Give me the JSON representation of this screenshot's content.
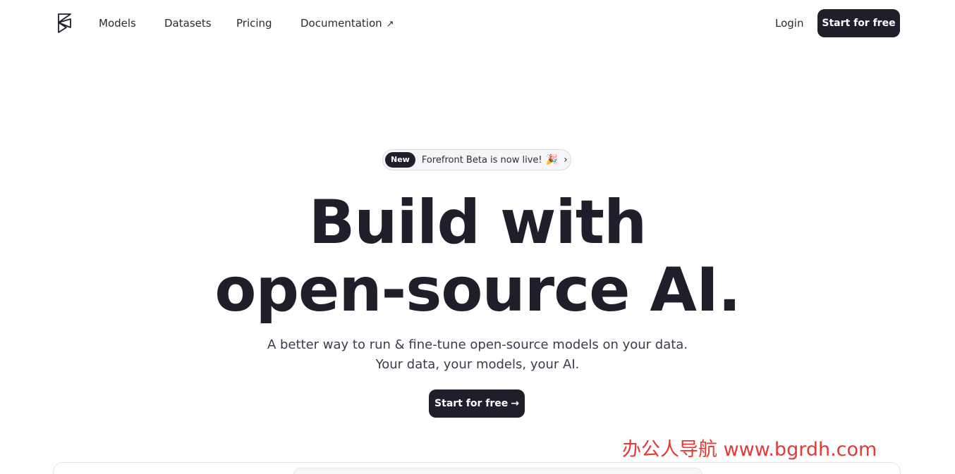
{
  "nav": {
    "links": [
      "Models",
      "Datasets",
      "Pricing",
      "Documentation"
    ],
    "docs_external_icon": "↗",
    "login": "Login",
    "cta": "Start for free"
  },
  "announcement": {
    "badge": "New",
    "text": "Forefront Beta is now live!",
    "emoji": "🎉",
    "chevron": "›"
  },
  "hero": {
    "title_line1": "Build with",
    "title_line2": "open-source AI.",
    "subtitle_line1": "A better way to run & fine-tune open-source models on your data.",
    "subtitle_line2": "Your data, your models, your AI.",
    "cta": "Start for free",
    "cta_arrow": "→"
  },
  "watermark": "办公人导航  www.bgrdh.com",
  "colors": {
    "primary_dark": "#1f1e2b",
    "watermark_red": "#e53935"
  }
}
